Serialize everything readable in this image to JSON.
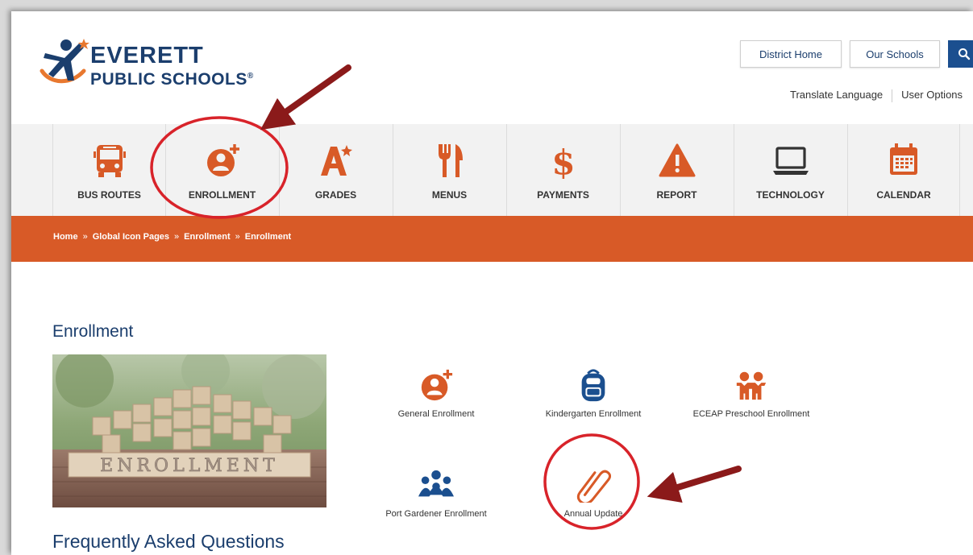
{
  "logo": {
    "line1": "EVERETT",
    "line2": "PUBLIC SCHOOLS",
    "reg": "®"
  },
  "header": {
    "district_home": "District Home",
    "our_schools": "Our Schools",
    "translate": "Translate Language",
    "user_options": "User Options"
  },
  "nav": [
    {
      "label": "BUS ROUTES",
      "icon": "bus-icon"
    },
    {
      "label": "ENROLLMENT",
      "icon": "enrollment-icon"
    },
    {
      "label": "GRADES",
      "icon": "grades-icon"
    },
    {
      "label": "MENUS",
      "icon": "fork-knife-icon"
    },
    {
      "label": "PAYMENTS",
      "icon": "dollar-icon"
    },
    {
      "label": "REPORT",
      "icon": "warning-icon"
    },
    {
      "label": "TECHNOLOGY",
      "icon": "laptop-icon"
    },
    {
      "label": "CALENDAR",
      "icon": "calendar-icon"
    }
  ],
  "breadcrumb": [
    "Home",
    "Global Icon Pages",
    "Enrollment",
    "Enrollment"
  ],
  "breadcrumb_sep": "»",
  "content": {
    "title": "Enrollment",
    "photo_word": "ENROLLMENT",
    "faq_title": "Frequently Asked Questions",
    "tiles": [
      {
        "label": "General Enrollment",
        "icon": "enrollment-icon"
      },
      {
        "label": "Kindergarten Enrollment",
        "icon": "backpack-icon"
      },
      {
        "label": "ECEAP Preschool Enrollment",
        "icon": "children-icon"
      },
      {
        "label": "Port Gardener Enrollment",
        "icon": "group-icon"
      },
      {
        "label": "Annual Update",
        "icon": "paperclip-icon"
      }
    ]
  },
  "colors": {
    "accent_orange": "#d85a27",
    "navy": "#1b3e6d",
    "search_blue": "#1b4f8f",
    "annotation_red": "#d8232a",
    "annotation_arrow": "#8b1a1a"
  }
}
